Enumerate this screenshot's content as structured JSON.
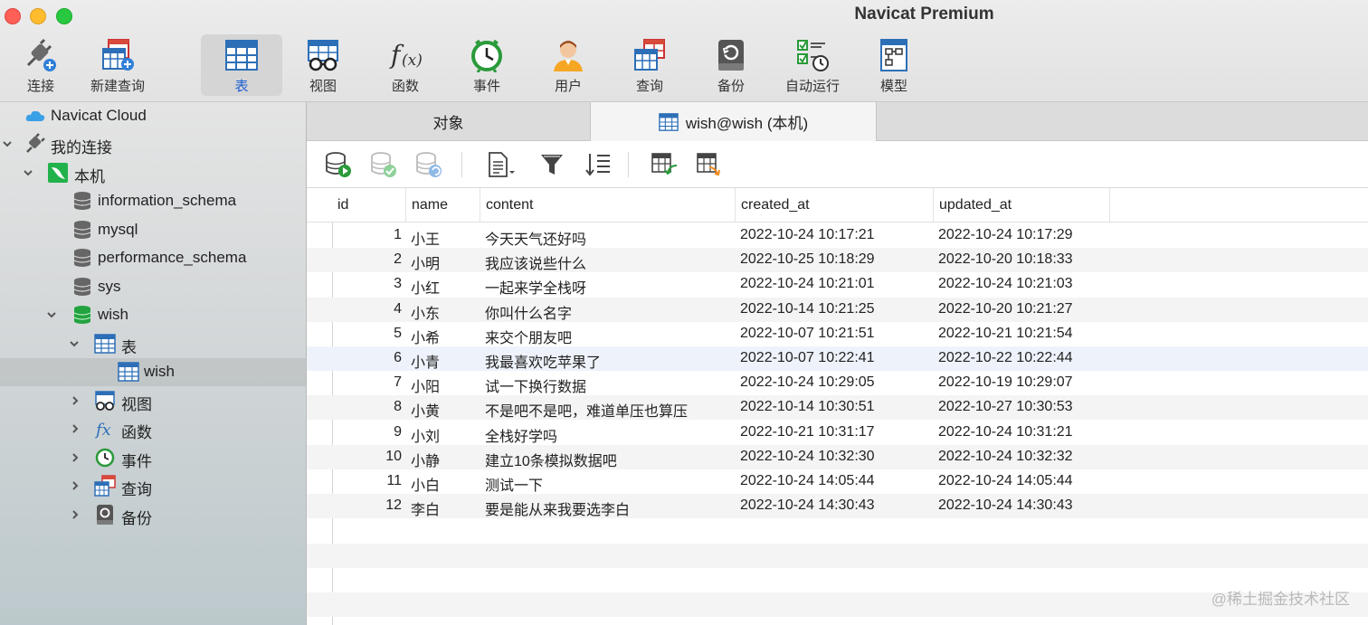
{
  "window": {
    "title": "Navicat Premium"
  },
  "toolbar": {
    "items": [
      {
        "label": "连接",
        "icon": "connection-plug-icon"
      },
      {
        "label": "新建查询",
        "icon": "new-query-icon"
      },
      {
        "label": "表",
        "icon": "table-icon",
        "active": true
      },
      {
        "label": "视图",
        "icon": "view-glasses-icon"
      },
      {
        "label": "函数",
        "icon": "function-fx-icon"
      },
      {
        "label": "事件",
        "icon": "event-clock-icon"
      },
      {
        "label": "用户",
        "icon": "user-icon"
      },
      {
        "label": "查询",
        "icon": "query-icon"
      },
      {
        "label": "备份",
        "icon": "backup-icon"
      },
      {
        "label": "自动运行",
        "icon": "automation-checklist-icon"
      },
      {
        "label": "模型",
        "icon": "model-icon"
      }
    ]
  },
  "sidebar": {
    "items": [
      {
        "label": "Navicat Cloud",
        "icon": "cloud-icon"
      },
      {
        "label": "我的连接",
        "icon": "connection-plug-icon",
        "expanded": true
      },
      {
        "label": "本机",
        "icon": "mysql-server-icon",
        "expanded": true
      },
      {
        "label": "information_schema",
        "icon": "database-icon"
      },
      {
        "label": "mysql",
        "icon": "database-icon"
      },
      {
        "label": "performance_schema",
        "icon": "database-icon"
      },
      {
        "label": "sys",
        "icon": "database-icon"
      },
      {
        "label": "wish",
        "icon": "database-icon",
        "expanded": true
      },
      {
        "label": "表",
        "icon": "table-icon",
        "expanded": true
      },
      {
        "label": "wish",
        "icon": "table-icon",
        "selected": true
      },
      {
        "label": "视图",
        "icon": "view-glasses-icon"
      },
      {
        "label": "函数",
        "icon": "function-fx-icon"
      },
      {
        "label": "事件",
        "icon": "event-clock-icon"
      },
      {
        "label": "查询",
        "icon": "query-icon"
      },
      {
        "label": "备份",
        "icon": "backup-icon"
      }
    ]
  },
  "tabs": {
    "objects": "对象",
    "active": "wish@wish (本机)"
  },
  "table": {
    "columns": [
      "id",
      "name",
      "content",
      "created_at",
      "updated_at"
    ],
    "rows": [
      [
        "1",
        "小王",
        "今天天气还好吗",
        "2022-10-24 10:17:21",
        "2022-10-24 10:17:29"
      ],
      [
        "2",
        "小明",
        "我应该说些什么",
        "2022-10-25 10:18:29",
        "2022-10-20 10:18:33"
      ],
      [
        "3",
        "小红",
        "一起来学全栈呀",
        "2022-10-24 10:21:01",
        "2022-10-24 10:21:03"
      ],
      [
        "4",
        "小东",
        "你叫什么名字",
        "2022-10-14 10:21:25",
        "2022-10-20 10:21:27"
      ],
      [
        "5",
        "小希",
        "来交个朋友吧",
        "2022-10-07 10:21:51",
        "2022-10-21 10:21:54"
      ],
      [
        "6",
        "小青",
        "我最喜欢吃苹果了",
        "2022-10-07 10:22:41",
        "2022-10-22 10:22:44"
      ],
      [
        "7",
        "小阳",
        "试一下换行数据",
        "2022-10-24 10:29:05",
        "2022-10-19 10:29:07"
      ],
      [
        "8",
        "小黄",
        "不是吧不是吧，难道单压也算压",
        "2022-10-14 10:30:51",
        "2022-10-27 10:30:53"
      ],
      [
        "9",
        "小刘",
        "全栈好学吗",
        "2022-10-21 10:31:17",
        "2022-10-24 10:31:21"
      ],
      [
        "10",
        "小静",
        "建立10条模拟数据吧",
        "2022-10-24 10:32:30",
        "2022-10-24 10:32:32"
      ],
      [
        "11",
        "小白",
        "测试一下",
        "2022-10-24 14:05:44",
        "2022-10-24 14:05:44"
      ],
      [
        "12",
        "李白",
        "要是能从来我要选李白",
        "2022-10-24 14:30:43",
        "2022-10-24 14:30:43"
      ]
    ]
  },
  "watermark": "@稀土掘金技术社区"
}
